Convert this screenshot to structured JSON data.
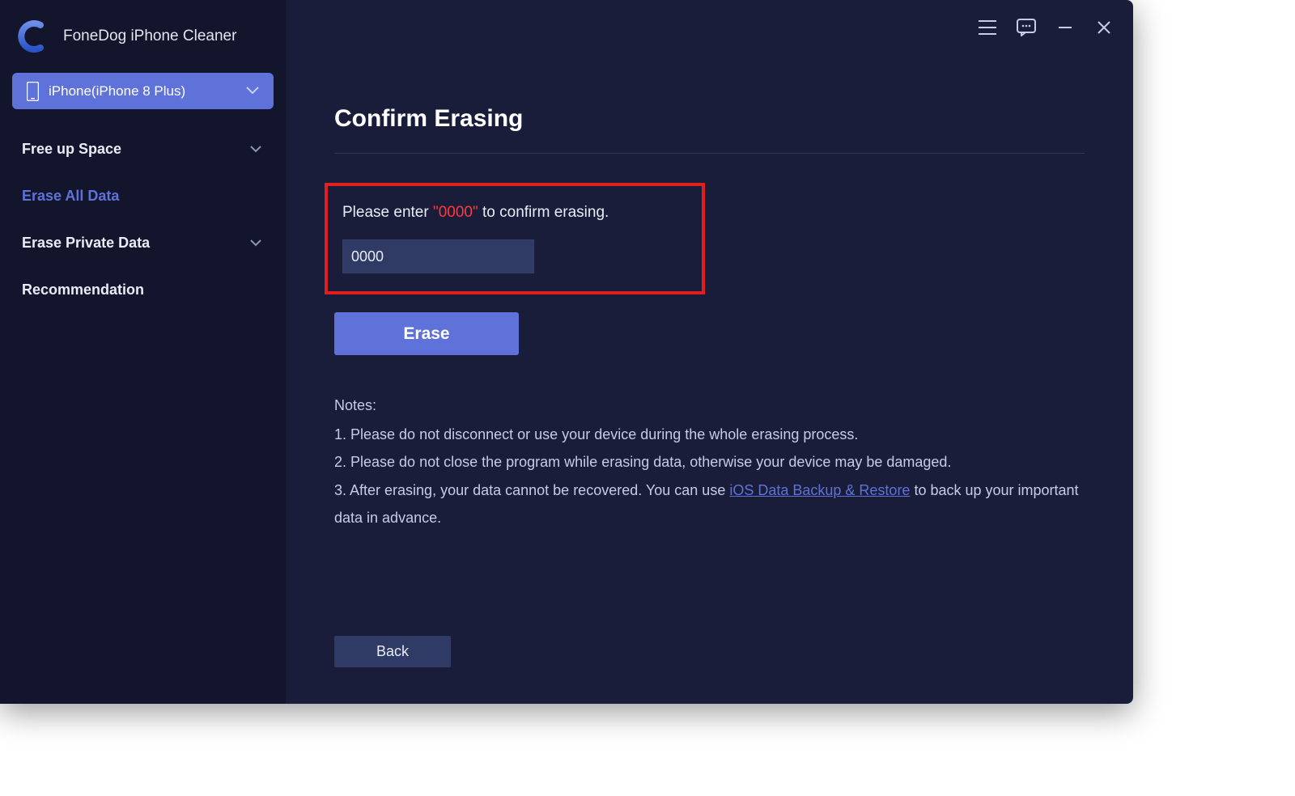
{
  "app": {
    "title": "FoneDog iPhone Cleaner"
  },
  "device": {
    "label": "iPhone(iPhone 8 Plus)"
  },
  "nav": {
    "free_up": "Free up Space",
    "erase_all": "Erase All Data",
    "erase_private": "Erase Private Data",
    "recommendation": "Recommendation"
  },
  "page": {
    "title": "Confirm Erasing",
    "prompt_pre": "Please enter ",
    "prompt_code": "\"0000\"",
    "prompt_post": " to confirm erasing.",
    "input_value": "0000",
    "erase_btn": "Erase",
    "back_btn": "Back"
  },
  "notes": {
    "heading": "Notes:",
    "n1": "1. Please do not disconnect or use your device during the whole erasing process.",
    "n2": "2. Please do not close the program while erasing data, otherwise your device may be damaged.",
    "n3_pre": "3. After erasing, your data cannot be recovered. You can use ",
    "n3_link": "iOS Data Backup & Restore",
    "n3_post": " to back up your important data in advance."
  }
}
